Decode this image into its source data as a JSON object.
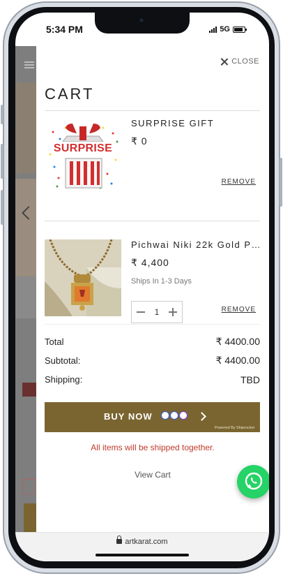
{
  "status": {
    "time": "5:34 PM",
    "network": "5G"
  },
  "drawer": {
    "close_label": "CLOSE",
    "title": "CART",
    "items": [
      {
        "name": "SURPRISE GIFT",
        "price": "₹ 0",
        "remove_label": "REMOVE",
        "image_text": "SURPRISE"
      },
      {
        "name": "Pichwai Niki 22k Gold P…",
        "price": "₹ 4,400",
        "shipping_note": "Ships In 1-3 Days",
        "quantity": "1",
        "remove_label": "REMOVE"
      }
    ],
    "totals": [
      {
        "label": "Total",
        "value": "₹ 4400.00"
      },
      {
        "label": "Subtotal:",
        "value": "₹ 4400.00"
      },
      {
        "label": "Shipping:",
        "value": "TBD"
      }
    ],
    "buy_now": {
      "label": "BUY NOW",
      "powered_by": "Powered By Shiprocket"
    },
    "shipping_message": "All items will be shipped together.",
    "view_cart_label": "View Cart"
  },
  "browser": {
    "url": "artkarat.com"
  },
  "colors": {
    "accent": "#7a6530",
    "message": "#c03a2b",
    "whatsapp": "#25d366"
  }
}
